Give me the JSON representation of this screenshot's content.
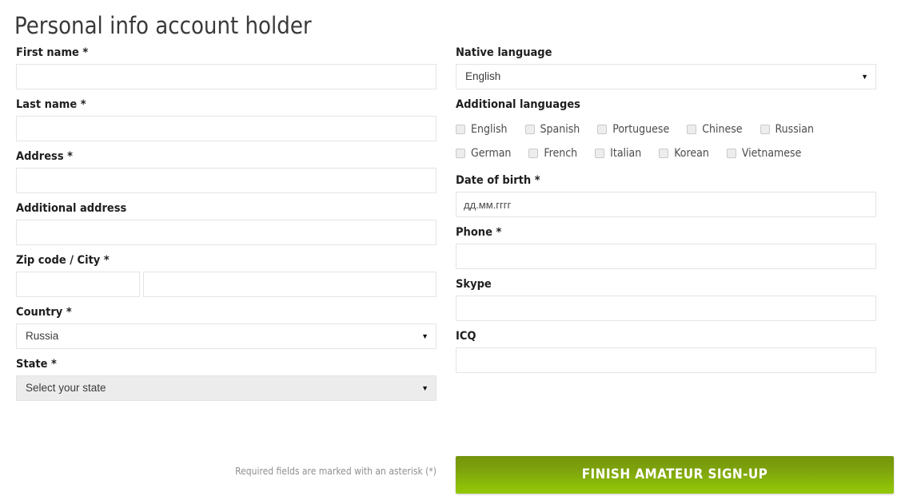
{
  "page": {
    "title": "Personal info account holder",
    "footnote": "Required fields are marked with an asterisk (*)"
  },
  "left_column": {
    "first_name": {
      "label": "First name *",
      "value": "",
      "placeholder": ""
    },
    "last_name": {
      "label": "Last name *",
      "value": "",
      "placeholder": ""
    },
    "address": {
      "label": "Address *",
      "value": "",
      "placeholder": ""
    },
    "additional_address": {
      "label": "Additional address",
      "value": "",
      "placeholder": ""
    },
    "zip_city": {
      "label": "Zip code / City *",
      "zip_value": "",
      "zip_placeholder": "",
      "city_value": "",
      "city_placeholder": ""
    },
    "country": {
      "label": "Country *",
      "selected": "Russia",
      "arrow": "▼",
      "disabled": false
    },
    "state": {
      "label": "State *",
      "selected": "Select your state",
      "arrow": "▼",
      "disabled": true
    }
  },
  "right_column": {
    "native_language": {
      "label": "Native language",
      "selected": "English",
      "arrow": "▼"
    },
    "additional_languages": {
      "label": "Additional languages",
      "rows": [
        [
          {
            "label": "English",
            "checked": false
          },
          {
            "label": "Spanish",
            "checked": false
          },
          {
            "label": "Portuguese",
            "checked": false
          },
          {
            "label": "Chinese",
            "checked": false
          },
          {
            "label": "Russian",
            "checked": false
          }
        ],
        [
          {
            "label": "German",
            "checked": false
          },
          {
            "label": "French",
            "checked": false
          },
          {
            "label": "Italian",
            "checked": false
          },
          {
            "label": "Korean",
            "checked": false
          },
          {
            "label": "Vietnamese",
            "checked": false
          }
        ]
      ]
    },
    "date_of_birth": {
      "label": "Date of birth *",
      "value": "",
      "placeholder": "дд.мм.гггг"
    },
    "phone": {
      "label": "Phone *",
      "value": "",
      "placeholder": ""
    },
    "skype": {
      "label": "Skype",
      "value": "",
      "placeholder": ""
    },
    "icq": {
      "label": "ICQ",
      "value": "",
      "placeholder": ""
    }
  },
  "submit": {
    "label": "FINISH AMATEUR SIGN-UP"
  },
  "colors": {
    "accent_green_top": "#74940d",
    "accent_green_bottom": "#92c707",
    "input_border": "#e4e4e4",
    "disabled_fill": "#ececec",
    "label_text": "#1f1f1f",
    "footnote_text": "#8f8f8f"
  }
}
